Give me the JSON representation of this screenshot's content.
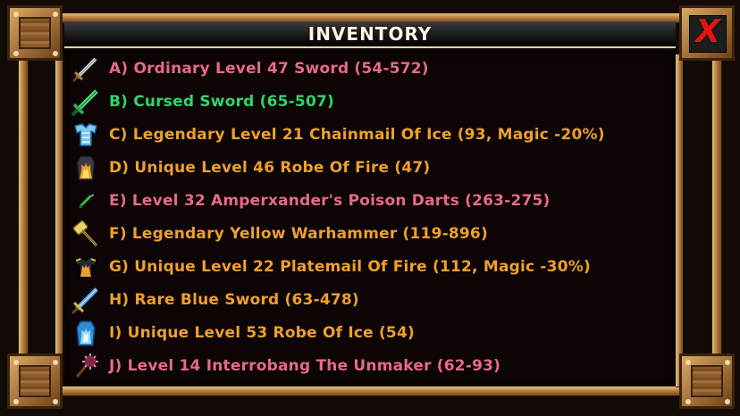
{
  "window": {
    "title": "INVENTORY",
    "close_label": "X"
  },
  "colors": {
    "ordinary": "#e86a88",
    "cursed": "#33d46a",
    "special": "#f0a02a",
    "close": "#e31313"
  },
  "items": [
    {
      "label": "A) Ordinary Level 47 Sword (54-572)",
      "color": "pink",
      "icon": "sword-icon"
    },
    {
      "label": "B) Cursed Sword (65-507)",
      "color": "green",
      "icon": "green-sword-icon"
    },
    {
      "label": "C) Legendary Level 21 Chainmail Of Ice (93, Magic -20%)",
      "color": "orange",
      "icon": "ice-chainmail-icon"
    },
    {
      "label": "D) Unique Level 46 Robe Of Fire (47)",
      "color": "orange",
      "icon": "fire-robe-icon"
    },
    {
      "label": "E) Level 32 Amperxander's Poison Darts (263-275)",
      "color": "pink",
      "icon": "poison-darts-icon"
    },
    {
      "label": "F) Legendary Yellow Warhammer (119-896)",
      "color": "orange",
      "icon": "warhammer-icon"
    },
    {
      "label": "G) Unique Level 22 Platemail Of Fire (112, Magic -30%)",
      "color": "orange",
      "icon": "fire-platemail-icon"
    },
    {
      "label": "H) Rare Blue Sword (63-478)",
      "color": "orange",
      "icon": "blue-sword-icon"
    },
    {
      "label": "I) Unique Level 53 Robe Of Ice (54)",
      "color": "orange",
      "icon": "ice-robe-icon"
    },
    {
      "label": "J) Level 14 Interrobang The Unmaker (62-93)",
      "color": "pink",
      "icon": "mace-icon"
    }
  ]
}
